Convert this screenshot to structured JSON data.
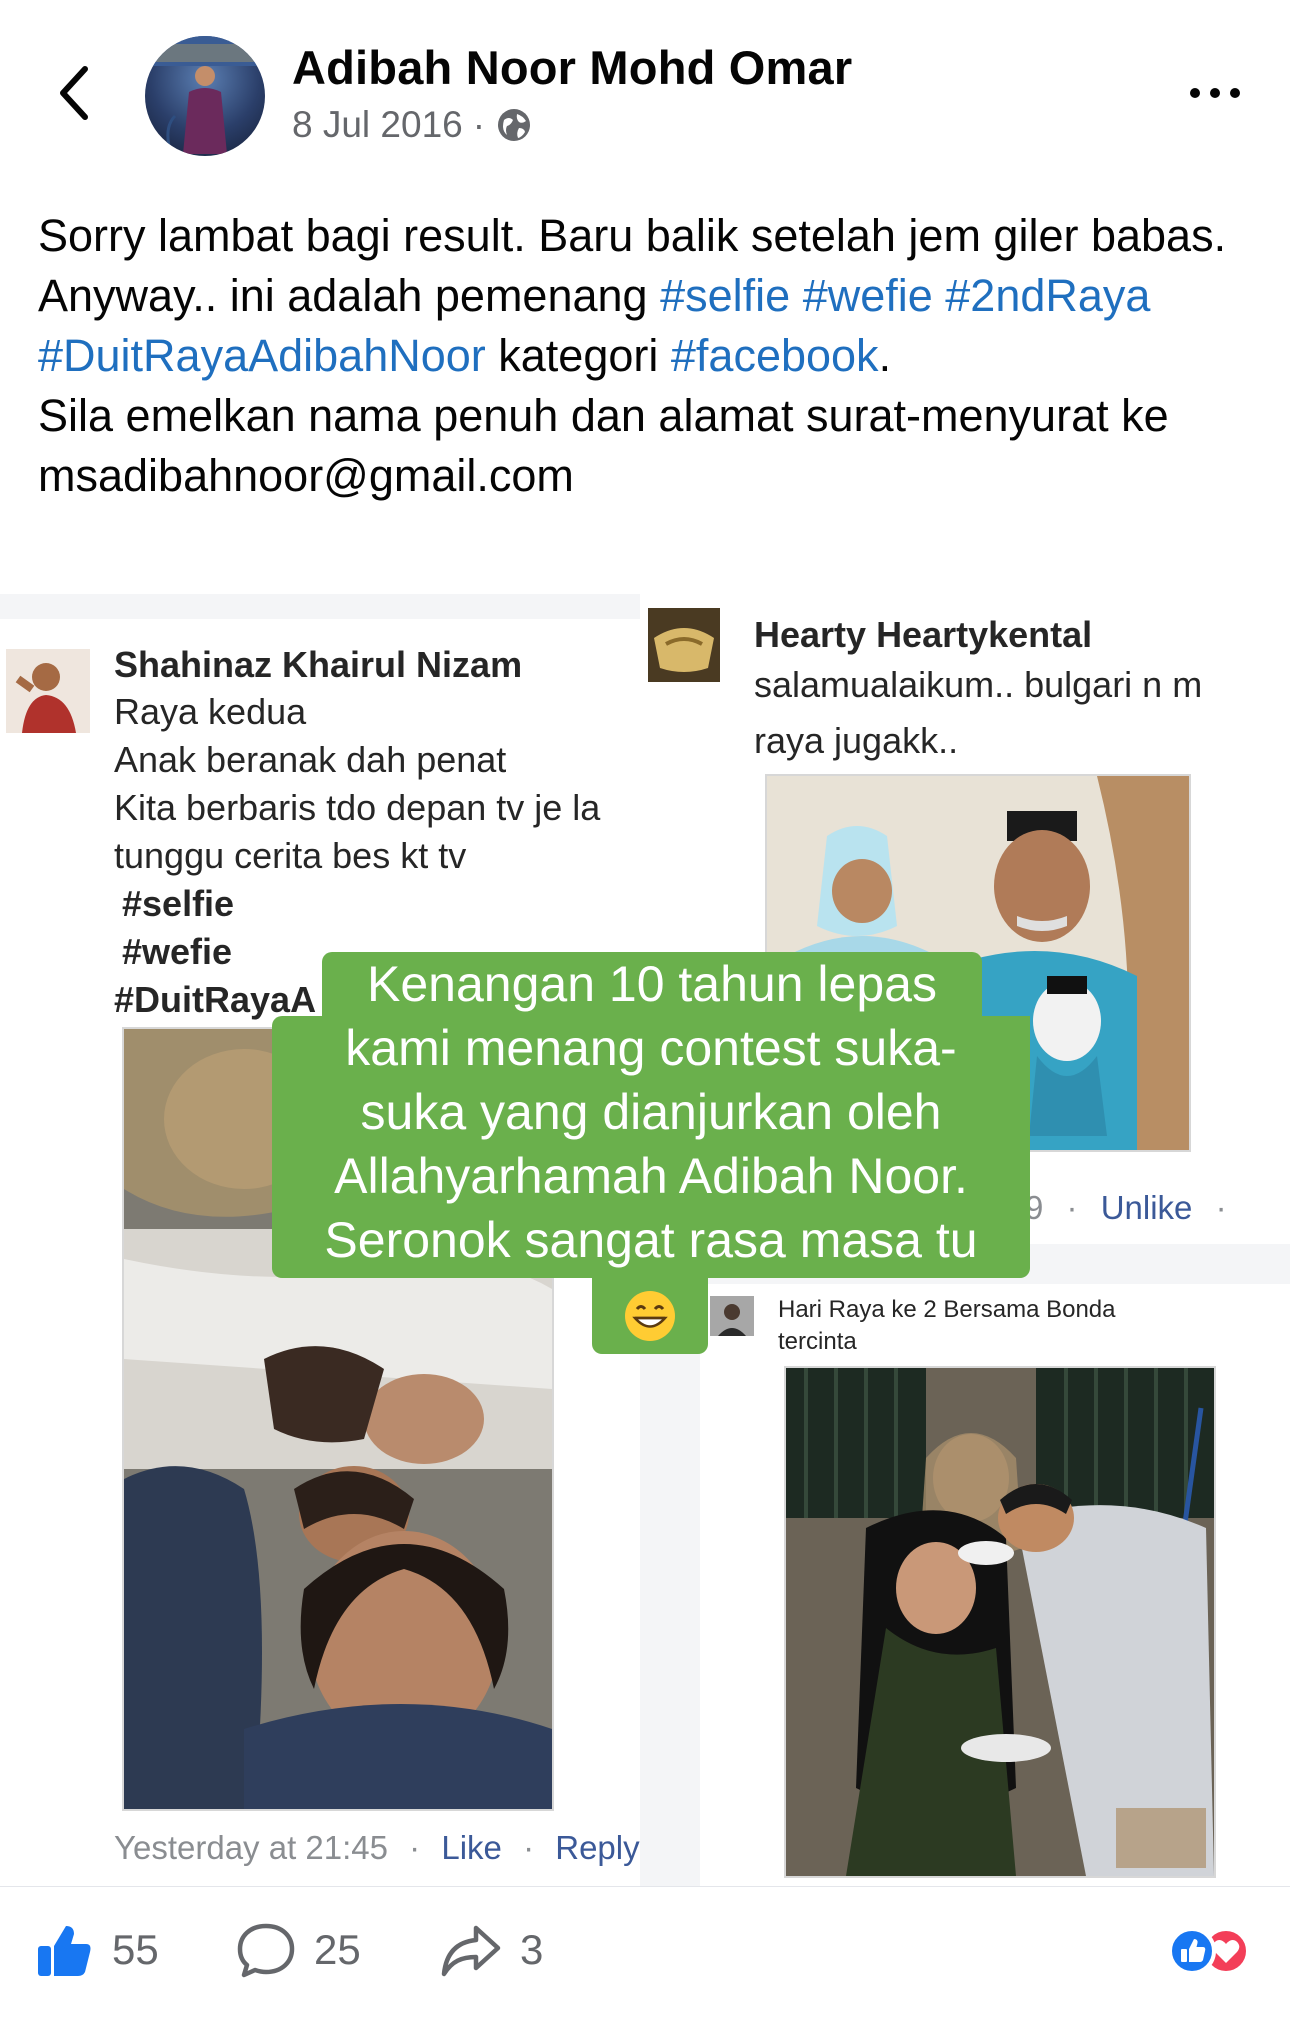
{
  "header": {
    "author_name": "Adibah Noor Mohd Omar",
    "date": "8 Jul 2016",
    "separator": "·",
    "privacy_icon": "globe-icon",
    "back_icon": "chevron-left-icon",
    "more_icon": "more-horizontal-icon"
  },
  "post": {
    "line1": "Sorry lambat bagi result. Baru balik setelah jem giler babas.",
    "line2_text": "Anyway.. ini adalah pemenang",
    "tag_selfie": "#selfie",
    "tag_wefie": "#wefie",
    "tag_2ndraya": "#2ndRaya",
    "tag_duitraya": "#DuitRayaAdibahNoor",
    "kategori": "kategori",
    "tag_facebook": "#facebook",
    "period": ".",
    "line3": "Sila emelkan nama penuh dan alamat surat-menyurat ke msadibahnoor@gmail.com"
  },
  "collage": {
    "left_comment": {
      "name": "Shahinaz Khairul Nizam",
      "lines": [
        "Raya kedua",
        "Anak beranak dah penat",
        "Kita berbaris tdo depan tv je la",
        "tunggu cerita bes kt tv"
      ],
      "tags": [
        "#selfie",
        "#wefie",
        "#DuitRayaA"
      ],
      "time": "Yesterday at 21:45",
      "dot": "·",
      "like": "Like",
      "reply": "Reply"
    },
    "right_top_comment": {
      "name": "Hearty Heartykental",
      "line1": "salamualaikum.. bulgari n m",
      "line2": "raya jugakk..",
      "partial_time": "9",
      "dot": "·",
      "unlike": "Unlike"
    },
    "right_bottom_comment": {
      "line1": "Hari Raya  ke 2 Bersama Bonda",
      "line2": "tercinta"
    },
    "overlay_caption": {
      "lines": [
        "Kenangan 10 tahun lepas",
        "kami menang contest suka-",
        "suka yang dianjurkan oleh",
        "Allahyarhamah Adibah Noor.",
        "Seronok sangat rasa masa tu"
      ],
      "emoji": "😁"
    }
  },
  "actions": {
    "like_count": "55",
    "comment_count": "25",
    "share_count": "3",
    "like_icon": "thumbs-up-icon",
    "comment_icon": "comment-bubble-icon",
    "share_icon": "share-arrow-icon",
    "reactions_icon": "like-love-reactions-icon"
  },
  "colors": {
    "hashtag": "#1f6fbf",
    "like_blue": "#1877f2",
    "love_red": "#f33e58",
    "caption_green": "#6ab04c"
  }
}
